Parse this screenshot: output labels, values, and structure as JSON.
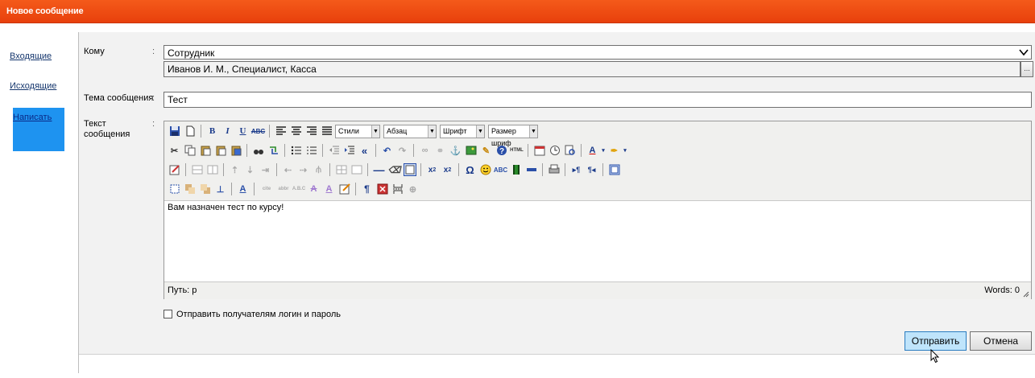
{
  "window": {
    "title": "Новое сообщение"
  },
  "sidebar": {
    "items": [
      {
        "label": "Входящие"
      },
      {
        "label": "Исходящие"
      },
      {
        "label": "Написать"
      }
    ]
  },
  "form": {
    "to_label": "Кому",
    "to_select_value": "Сотрудник",
    "recipient_value": "Иванов И. М., Специалист, Касса",
    "recipient_btn": "...",
    "subject_label": "Тема сообщения",
    "subject_value": "Тест",
    "body_label_1": "Текст",
    "body_label_2": "сообщения",
    "colon": ":"
  },
  "editor": {
    "styles_dropdown": "Стили",
    "paragraph_dropdown": "Абзац",
    "font_dropdown": "Шрифт",
    "size_dropdown": "Размер шриф",
    "content": "Вам назначен тест по курсу!",
    "path_label": "Путь: p",
    "words_label": "Words: 0"
  },
  "options": {
    "send_credentials_label": "Отправить получателям логин и пароль"
  },
  "buttons": {
    "send": "Отправить",
    "cancel": "Отмена"
  },
  "colors": {
    "title_bar": "#e8400c",
    "active_nav": "#1e93f0",
    "send_button": "#bfe4fb"
  }
}
